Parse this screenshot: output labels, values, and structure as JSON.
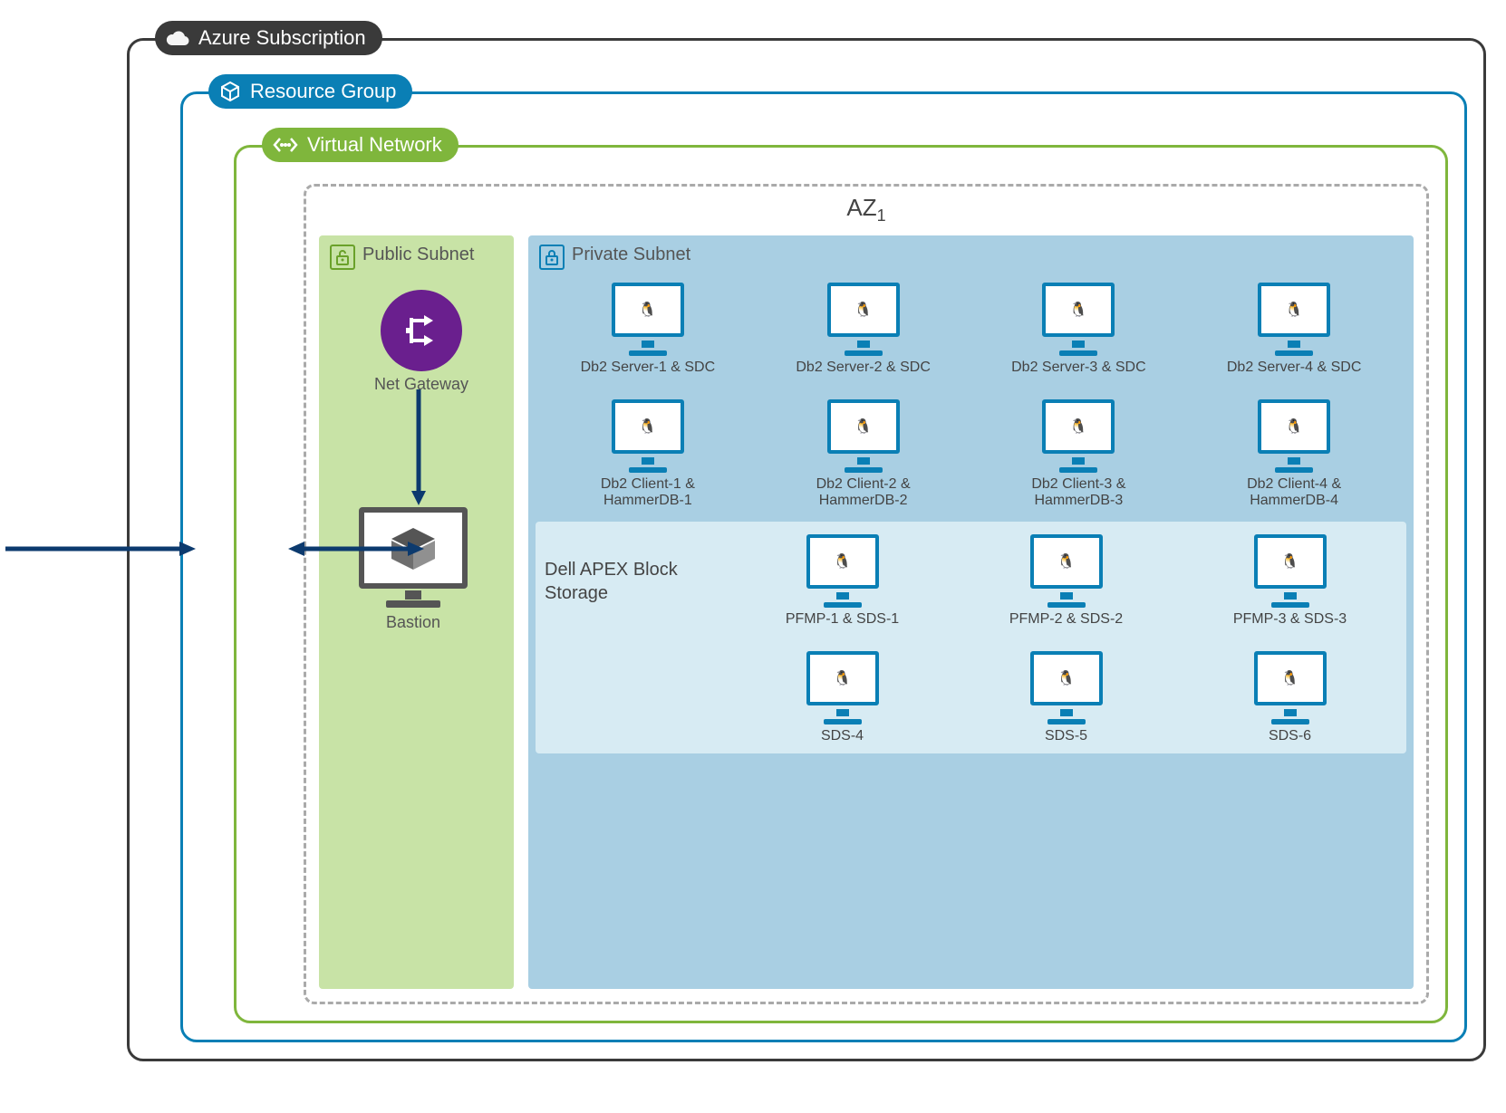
{
  "azure_subscription_label": "Azure Subscription",
  "resource_group_label": "Resource Group",
  "virtual_network_label": "Virtual Network",
  "az_label": "AZ",
  "az_index": "1",
  "public_subnet_label": "Public Subnet",
  "private_subnet_label": "Private Subnet",
  "net_gateway_label": "Net Gateway",
  "bastion_label": "Bastion",
  "apex_label": "Dell APEX Block Storage",
  "servers": [
    "Db2 Server-1 & SDC",
    "Db2 Server-2 & SDC",
    "Db2 Server-3 & SDC",
    "Db2 Server-4 & SDC"
  ],
  "clients": [
    "Db2 Client-1 & HammerDB-1",
    "Db2 Client-2 & HammerDB-2",
    "Db2 Client-3 & HammerDB-3",
    "Db2 Client-4 & HammerDB-4"
  ],
  "pfmp": [
    "PFMP-1 & SDS-1",
    "PFMP-2 & SDS-2",
    "PFMP-3 & SDS-3"
  ],
  "sds": [
    "SDS-4",
    "SDS-5",
    "SDS-6"
  ]
}
